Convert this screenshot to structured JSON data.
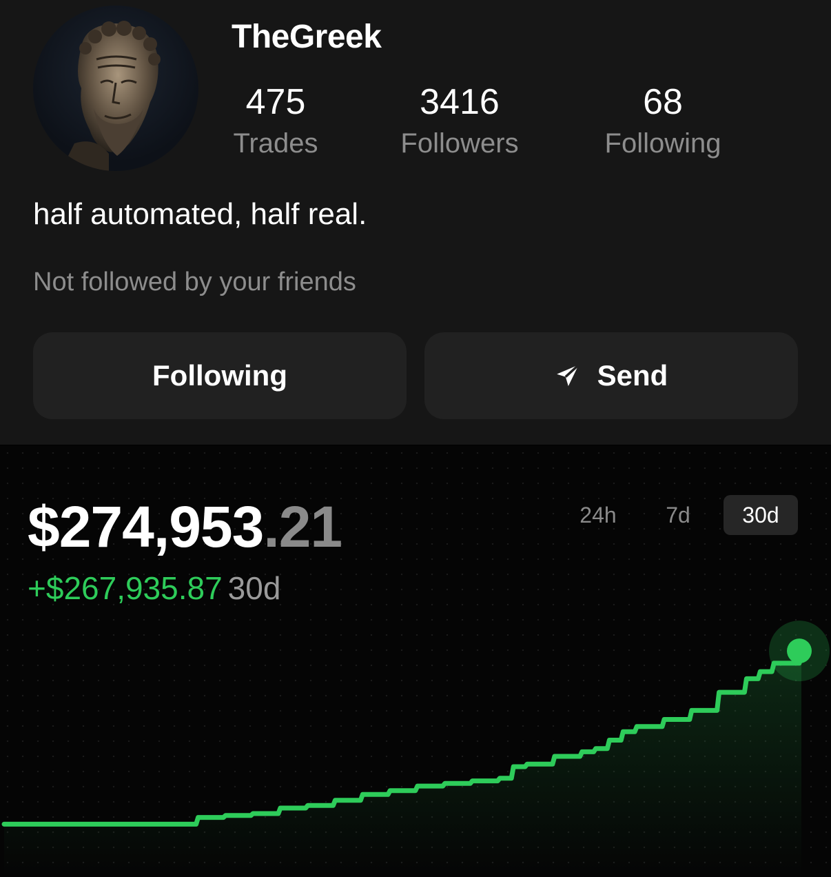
{
  "profile": {
    "username": "TheGreek",
    "stats": [
      {
        "value": "475",
        "label": "Trades"
      },
      {
        "value": "3416",
        "label": "Followers"
      },
      {
        "value": "68",
        "label": "Following"
      }
    ],
    "bio": "half automated, half real.",
    "friends_note": "Not followed by your friends",
    "buttons": {
      "following_label": "Following",
      "send_label": "Send",
      "send_icon": "paper-plane-icon"
    }
  },
  "portfolio": {
    "balance_main": "$274,953",
    "balance_cents": ".21",
    "change_amount": "+$267,935.87",
    "change_period": "30d",
    "ranges": [
      "24h",
      "7d",
      "30d"
    ],
    "selected_range": "30d"
  },
  "colors": {
    "accent_green": "#2ecc5a",
    "muted_text": "#8d8d8d",
    "panel_bg": "#161616",
    "button_bg": "#212121"
  },
  "chart_data": {
    "type": "line",
    "title": "",
    "xlabel": "",
    "ylabel": "",
    "grid": false,
    "x": [
      0,
      6,
      7,
      8,
      9,
      10,
      11,
      12,
      13,
      14,
      15,
      16,
      17,
      18,
      18.5,
      19,
      20,
      21,
      21.5,
      22,
      22.5,
      23,
      24,
      25,
      26,
      27,
      27.5,
      28,
      29
    ],
    "series": [
      {
        "values": [
          7017,
          7017,
          17500,
          20500,
          23500,
          32000,
          36000,
          44000,
          53000,
          59000,
          66000,
          70000,
          74000,
          78000,
          96000,
          100000,
          112000,
          119000,
          124000,
          137000,
          150000,
          158000,
          169000,
          183000,
          211000,
          232000,
          243000,
          256000,
          274953
        ]
      }
    ],
    "ylim": [
      0,
      290000
    ]
  }
}
